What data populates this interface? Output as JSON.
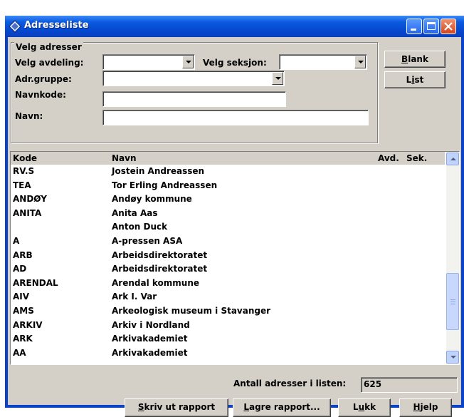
{
  "window": {
    "title": "Adresseliste"
  },
  "group": {
    "legend": "Velg adresser",
    "avdeling_label": "Velg avdeling:",
    "avdeling_value": "",
    "seksjon_label": "Velg seksjon:",
    "seksjon_value": "",
    "gruppe_label": "Adr.gruppe:",
    "gruppe_value": "",
    "navnkode_label": "Navnkode:",
    "navnkode_value": "",
    "navn_label": "Navn:",
    "navn_value": ""
  },
  "side_buttons": {
    "blank": {
      "key": "B",
      "rest": "lank"
    },
    "list": {
      "pre": "L",
      "key": "i",
      "rest": "st"
    }
  },
  "list": {
    "headers": {
      "kode": "Kode",
      "navn": "Navn",
      "avd": "Avd.",
      "sek": "Sek."
    },
    "rows": [
      {
        "kode": "RV.S",
        "navn": "Jostein Andreassen"
      },
      {
        "kode": "TEA",
        "navn": "Tor Erling Andreassen"
      },
      {
        "kode": "ANDØY",
        "navn": "Andøy kommune"
      },
      {
        "kode": "ANITA",
        "navn": "Anita Aas"
      },
      {
        "kode": "",
        "navn": "Anton Duck"
      },
      {
        "kode": "A",
        "navn": "A-pressen ASA"
      },
      {
        "kode": "ARB",
        "navn": "Arbeidsdirektoratet"
      },
      {
        "kode": "AD",
        "navn": "Arbeidsdirektoratet"
      },
      {
        "kode": "ARENDAL",
        "navn": "Arendal kommune"
      },
      {
        "kode": "AIV",
        "navn": "Ark I. Var"
      },
      {
        "kode": "AMS",
        "navn": "Arkeologisk museum i Stavanger"
      },
      {
        "kode": "ARKIV",
        "navn": "Arkiv i Nordland"
      },
      {
        "kode": "ARK",
        "navn": "Arkivakademiet"
      },
      {
        "kode": "AA",
        "navn": "Arkivakademiet"
      }
    ]
  },
  "footer": {
    "count_label": "Antall adresser i listen:",
    "count_value": "625",
    "skriv": {
      "key": "S",
      "rest": "kriv ut rapport"
    },
    "lagre": {
      "key": "L",
      "rest": "agre rapport..."
    },
    "lukk": {
      "pre": "L",
      "key": "u",
      "rest": "kk"
    },
    "hjelp": {
      "key": "H",
      "rest": "jelp"
    }
  },
  "icons": {
    "app": "diamond-app-icon",
    "minimize": "minimize-icon",
    "maximize": "maximize-icon",
    "close": "close-icon"
  }
}
